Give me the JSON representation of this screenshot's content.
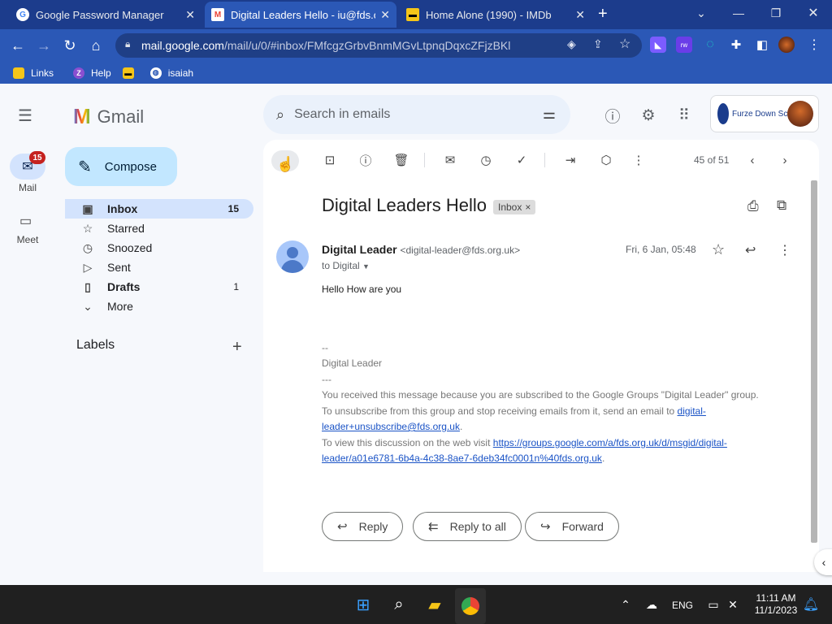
{
  "browser": {
    "tabs": [
      {
        "title": "Google Password Manager",
        "favicon": "google-icon",
        "close": "✕"
      },
      {
        "title": "Digital Leaders Hello - iu@fds.o",
        "favicon": "gmail-icon",
        "close": "✕"
      },
      {
        "title": "Home Alone (1990) - IMDb",
        "favicon": "imdb-icon",
        "close": "✕"
      }
    ],
    "new_tab": "+",
    "url_host": "mail.google.com",
    "url_path": "/mail/u/0/#inbox/FMfcgzGrbvBnmMGvLtpnqDqxcZFjzBKl",
    "bookmarks": [
      "Links",
      "Help",
      "isaiah"
    ],
    "ext_badge": "rw"
  },
  "gmail": {
    "logo_text": "Gmail",
    "search_placeholder": "Search in emails",
    "compose": "Compose",
    "rail": {
      "mail_label": "Mail",
      "mail_badge": "15",
      "meet_label": "Meet"
    },
    "folders": [
      {
        "label": "Inbox",
        "count": "15",
        "icon": "inbox-icon",
        "glyph": "▣"
      },
      {
        "label": "Starred",
        "count": "",
        "icon": "star-icon",
        "glyph": "☆"
      },
      {
        "label": "Snoozed",
        "count": "",
        "icon": "clock-icon",
        "glyph": "◷"
      },
      {
        "label": "Sent",
        "count": "",
        "icon": "send-icon",
        "glyph": "▷"
      },
      {
        "label": "Drafts",
        "count": "1",
        "icon": "draft-icon",
        "glyph": "▯"
      },
      {
        "label": "More",
        "count": "",
        "icon": "chevron-down-icon",
        "glyph": "⌄"
      }
    ],
    "labels_heading": "Labels",
    "account": {
      "school_name": "Furze Down School"
    },
    "pager": "45 of 51"
  },
  "email": {
    "subject": "Digital Leaders Hello",
    "chip": "Inbox",
    "sender_name": "Digital Leader",
    "sender_email": "<digital-leader@fds.org.uk>",
    "to_line": "to Digital",
    "date": "Fri, 6 Jan, 05:48",
    "greeting": "Hello  How are you",
    "sig_dash": "--",
    "sig_name": "Digital Leader",
    "sig_sep": "---",
    "footer1": "You received this message because you are subscribed to the Google Groups \"Digital Leader\" group.",
    "footer2_pre": "To unsubscribe from this group and stop receiving emails from it, send an email to ",
    "footer2_link": "digital-leader+unsubscribe@fds.org.uk",
    "footer2_post": ".",
    "footer3_pre": "To view this discussion on the web visit ",
    "footer3_link": "https://groups.google.com/a/fds.org.uk/d/msgid/digital-leader/a01e6781-6b4a-4c38-8ae7-6deb34fc0001n%40fds.org.uk",
    "footer3_post": "."
  },
  "buttons": {
    "reply": "Reply",
    "reply_all": "Reply to all",
    "forward": "Forward"
  },
  "taskbar": {
    "lang": "ENG",
    "time": "11:11 AM",
    "date": "11/1/2023"
  },
  "colors": {
    "tabbar": "#1c3c8c",
    "toolbar": "#2b58b6",
    "selected_folder": "#d3e3fd",
    "compose": "#c2e7ff"
  }
}
